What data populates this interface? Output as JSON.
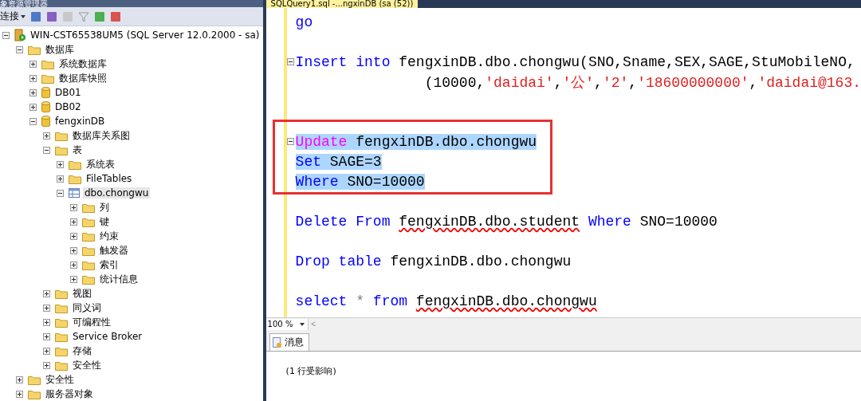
{
  "explorer": {
    "title": "象资源管理器",
    "toolbar": {
      "connect": "连接"
    },
    "tree": [
      {
        "label": "WIN-CST65538UM5 (SQL Server 12.0.2000 - sa)",
        "kind": "server",
        "expanded": true,
        "selected": false,
        "children": [
          {
            "label": "数据库",
            "kind": "folder",
            "expanded": true,
            "selected": false,
            "children": [
              {
                "label": "系统数据库",
                "kind": "folder",
                "expanded": false,
                "selected": false
              },
              {
                "label": "数据库快照",
                "kind": "folder",
                "expanded": false,
                "selected": false
              },
              {
                "label": "DB01",
                "kind": "database",
                "expanded": false,
                "selected": false
              },
              {
                "label": "DB02",
                "kind": "database",
                "expanded": false,
                "selected": false
              },
              {
                "label": "fengxinDB",
                "kind": "database",
                "expanded": true,
                "selected": false,
                "children": [
                  {
                    "label": "数据库关系图",
                    "kind": "folder",
                    "expanded": false,
                    "selected": false
                  },
                  {
                    "label": "表",
                    "kind": "folder",
                    "expanded": true,
                    "selected": false,
                    "children": [
                      {
                        "label": "系统表",
                        "kind": "folder",
                        "expanded": false,
                        "selected": false
                      },
                      {
                        "label": "FileTables",
                        "kind": "folder",
                        "expanded": false,
                        "selected": false
                      },
                      {
                        "label": "dbo.chongwu",
                        "kind": "table",
                        "expanded": true,
                        "selected": true,
                        "children": [
                          {
                            "label": "列",
                            "kind": "folder",
                            "expanded": false,
                            "selected": false
                          },
                          {
                            "label": "键",
                            "kind": "folder",
                            "expanded": false,
                            "selected": false
                          },
                          {
                            "label": "约束",
                            "kind": "folder",
                            "expanded": false,
                            "selected": false
                          },
                          {
                            "label": "触发器",
                            "kind": "folder",
                            "expanded": false,
                            "selected": false
                          },
                          {
                            "label": "索引",
                            "kind": "folder",
                            "expanded": false,
                            "selected": false
                          },
                          {
                            "label": "统计信息",
                            "kind": "folder",
                            "expanded": false,
                            "selected": false
                          }
                        ]
                      }
                    ]
                  },
                  {
                    "label": "视图",
                    "kind": "folder",
                    "expanded": false,
                    "selected": false
                  },
                  {
                    "label": "同义词",
                    "kind": "folder",
                    "expanded": false,
                    "selected": false
                  },
                  {
                    "label": "可编程性",
                    "kind": "folder",
                    "expanded": false,
                    "selected": false
                  },
                  {
                    "label": "Service Broker",
                    "kind": "folder",
                    "expanded": false,
                    "selected": false
                  },
                  {
                    "label": "存储",
                    "kind": "folder",
                    "expanded": false,
                    "selected": false
                  },
                  {
                    "label": "安全性",
                    "kind": "folder",
                    "expanded": false,
                    "selected": false
                  }
                ]
              }
            ]
          },
          {
            "label": "安全性",
            "kind": "folder",
            "expanded": false,
            "selected": false
          },
          {
            "label": "服务器对象",
            "kind": "folder",
            "expanded": false,
            "selected": false
          }
        ]
      }
    ]
  },
  "editor": {
    "tab": "SQLQuery1.sql -...ngxinDB (sa (52))",
    "lines": [
      {
        "kind": "code",
        "selected": false,
        "tokens": [
          {
            "text": "go",
            "kind": "keyword"
          }
        ]
      },
      {
        "kind": "blank"
      },
      {
        "kind": "code",
        "selected": false,
        "fold": true,
        "tokens": [
          {
            "text": "Insert into",
            "kind": "keyword"
          },
          {
            "text": " fengxinDB.dbo.chongwu(SNO,Sname,SEX,SAGE,StuMobileNO,",
            "kind": "plain"
          }
        ]
      },
      {
        "kind": "code",
        "selected": false,
        "tokens": [
          {
            "text": "               (10000,",
            "kind": "plain"
          },
          {
            "text": "'daidai'",
            "kind": "string"
          },
          {
            "text": ",",
            "kind": "plain"
          },
          {
            "text": "'公'",
            "kind": "string"
          },
          {
            "text": ",",
            "kind": "plain"
          },
          {
            "text": "'2'",
            "kind": "string"
          },
          {
            "text": ",",
            "kind": "plain"
          },
          {
            "text": "'18600000000'",
            "kind": "string"
          },
          {
            "text": ",",
            "kind": "plain"
          },
          {
            "text": "'daidai@163.",
            "kind": "string"
          }
        ]
      },
      {
        "kind": "blank"
      },
      {
        "kind": "blank"
      },
      {
        "kind": "code",
        "selected": true,
        "fold": true,
        "tokens": [
          {
            "text": "Update",
            "kind": "function"
          },
          {
            "text": " fengxinDB.dbo.chongwu",
            "kind": "plain"
          }
        ]
      },
      {
        "kind": "code",
        "selected": true,
        "tokens": [
          {
            "text": "Set",
            "kind": "keyword"
          },
          {
            "text": " SAGE=3",
            "kind": "plain"
          }
        ]
      },
      {
        "kind": "code",
        "selected": true,
        "tokens": [
          {
            "text": "Where",
            "kind": "keyword"
          },
          {
            "text": " SNO=10000",
            "kind": "plain"
          }
        ]
      },
      {
        "kind": "blank"
      },
      {
        "kind": "code",
        "selected": false,
        "tokens": [
          {
            "text": "Delete From ",
            "kind": "keyword"
          },
          {
            "text": "fengxinDB.dbo.student",
            "kind": "plain",
            "error": true
          },
          {
            "text": " Where",
            "kind": "keyword"
          },
          {
            "text": " SNO=10000",
            "kind": "plain"
          }
        ]
      },
      {
        "kind": "blank"
      },
      {
        "kind": "code",
        "selected": false,
        "tokens": [
          {
            "text": "Drop table",
            "kind": "keyword"
          },
          {
            "text": " fengxinDB.dbo.chongwu",
            "kind": "plain"
          }
        ]
      },
      {
        "kind": "blank"
      },
      {
        "kind": "code",
        "selected": false,
        "tokens": [
          {
            "text": "select",
            "kind": "keyword"
          },
          {
            "text": " * ",
            "kind": "operator"
          },
          {
            "text": "from ",
            "kind": "keyword"
          },
          {
            "text": "fengxinDB.dbo.chongwu",
            "kind": "plain",
            "error": true
          }
        ]
      }
    ],
    "zoom": "100 %",
    "scroll_left": "<"
  },
  "results": {
    "tabs": [
      {
        "label": "消息",
        "selected": true
      }
    ],
    "message": "(1 行受影响)"
  }
}
